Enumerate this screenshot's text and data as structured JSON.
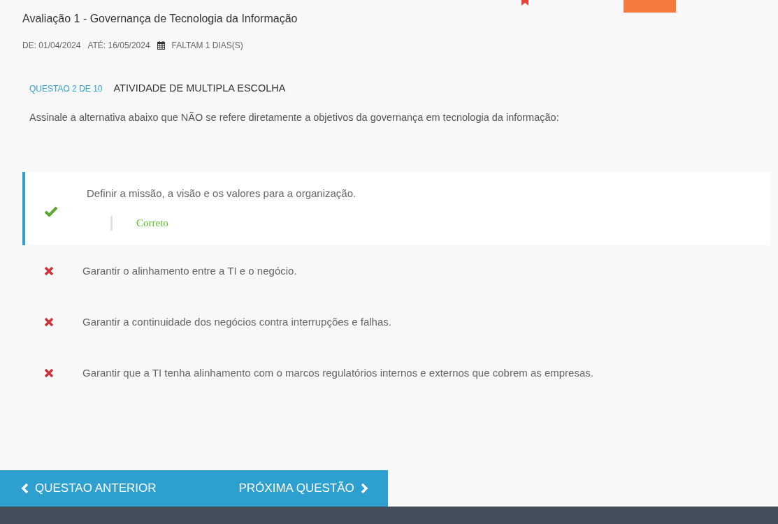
{
  "header": {
    "title": "Avaliação 1 - Governança de Tecnologia da Informação",
    "start": "DE: 01/04/2024",
    "end": "ATÉ: 16/05/2024",
    "remaining": "FALTAM 1 DIAS(S)"
  },
  "question": {
    "counter": "QUESTAO 2 DE 10",
    "type": "ATIVIDADE DE MULTIPLA ESCOLHA",
    "statement": "Assinale a alternativa abaixo que NÃO se refere diretamente a objetivos da governança em tecnologia da informação:"
  },
  "options": [
    {
      "text": "Definir a missão, a visão e os valores para a organização.",
      "kind": "correct",
      "selected": true,
      "feedback": "Correto"
    },
    {
      "text": "Garantir o alinhamento entre a TI e o negócio.",
      "kind": "wrong",
      "selected": false
    },
    {
      "text": "Garantir a continuidade dos negócios contra interrupções e falhas.",
      "kind": "wrong",
      "selected": false
    },
    {
      "text": "Garantir que a TI tenha alinhamento com o marcos regulatórios internos e externos que cobrem as empresas.",
      "kind": "wrong",
      "selected": false
    }
  ],
  "nav": {
    "previous": "QUESTAO ANTERIOR",
    "next": "PRÓXIMA QUESTÃO"
  }
}
